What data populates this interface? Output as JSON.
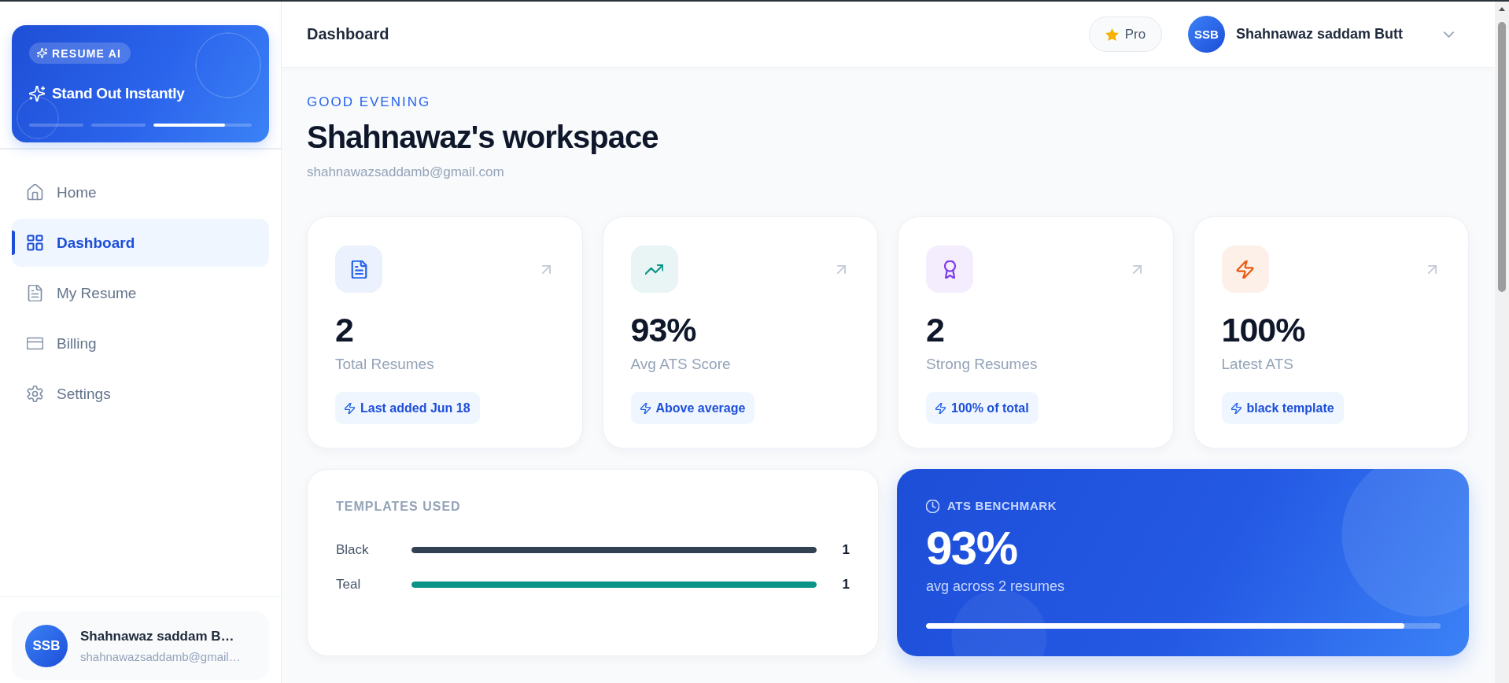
{
  "sidebar": {
    "promo": {
      "badge": "RESUME AI",
      "title": "Stand Out Instantly",
      "indicators": [
        {
          "selected": false
        },
        {
          "selected": false
        },
        {
          "selected": true,
          "level": 0.73
        }
      ]
    },
    "nav": [
      {
        "label": "Home",
        "selected": false
      },
      {
        "label": "Dashboard",
        "selected": true
      },
      {
        "label": "My Resume",
        "selected": false
      },
      {
        "label": "Billing",
        "selected": false
      },
      {
        "label": "Settings",
        "selected": false
      }
    ],
    "user": {
      "initials": "SSB",
      "name": "Shahnawaz saddam B…",
      "email": "shahnawazsaddamb@gmail…"
    }
  },
  "header": {
    "title": "Dashboard",
    "pro_button": "Pro",
    "user": {
      "initials": "SSB",
      "name": "Shahnawaz saddam Butt"
    }
  },
  "greeting": {
    "eyebrow": "GOOD EVENING",
    "title": "Shahnawaz's workspace",
    "email": "shahnawazsaddamb@gmail.com"
  },
  "stats": [
    {
      "value": "2",
      "label": "Total Resumes",
      "note": "Last added Jun 18",
      "color": "#2563eb"
    },
    {
      "value": "93%",
      "label": "Avg ATS Score",
      "note": "Above average",
      "color": "#0d9488"
    },
    {
      "value": "2",
      "label": "Strong Resumes",
      "note": "100% of total",
      "color": "#7c3aed"
    },
    {
      "value": "100%",
      "label": "Latest ATS",
      "note": "black template",
      "color": "#ea580c"
    }
  ],
  "templates": {
    "title": "TEMPLATES USED",
    "rows": [
      {
        "name": "Black",
        "count": "1",
        "level": 1,
        "color": "#334155"
      },
      {
        "name": "Teal",
        "count": "1",
        "level": 1,
        "color": "#0d9488"
      }
    ]
  },
  "benchmark": {
    "title": "ATS BENCHMARK",
    "value": "93%",
    "caption": "avg across 2 resumes",
    "level": 0.93
  }
}
